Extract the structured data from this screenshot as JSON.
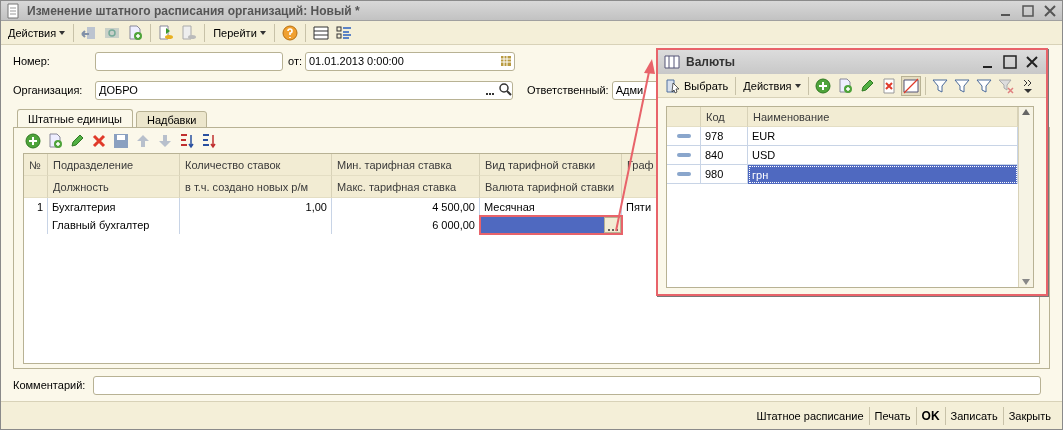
{
  "window": {
    "title": "Изменение штатного расписания организаций: Новый *"
  },
  "toolbar": {
    "actions_menu": "Действия",
    "goto_menu": "Перейти"
  },
  "form": {
    "number": {
      "label": "Номер:"
    },
    "date": {
      "label": "от:",
      "value": "01.01.2013  0:00:00"
    },
    "organization": {
      "label": "Организация:",
      "value": "ДОБРО"
    },
    "responsible": {
      "label": "Ответственный:",
      "value": "Адми"
    }
  },
  "tabs": [
    {
      "label": "Штатные единицы",
      "selected": true
    },
    {
      "label": "Надбавки",
      "selected": false
    }
  ],
  "table": {
    "columns": [
      {
        "header": "№"
      },
      {
        "header": "Подразделение",
        "subheader": "Должность"
      },
      {
        "header": "Количество ставок",
        "subheader": "в т.ч. создано новых р/м"
      },
      {
        "header": "Мин. тарифная ставка",
        "subheader": "Макс. тарифная ставка"
      },
      {
        "header": "Вид тарифной ставки",
        "subheader": "Валюта тарифной ставки"
      },
      {
        "header": "Граф"
      }
    ],
    "rows": [
      {
        "number": "1",
        "department": "Бухгалтерия",
        "position": "Главный бухгалтер",
        "rate_count": "1,00",
        "min_rate": "4 500,00",
        "max_rate": "6 000,00",
        "rate_kind": "Месячная",
        "currency_editing": true,
        "column_6": "Пяти"
      }
    ]
  },
  "comment": {
    "label": "Комментарий:"
  },
  "footer_buttons": [
    {
      "label": "Штатное расписание",
      "default": false
    },
    {
      "label": "Печать",
      "default": false
    },
    {
      "label": "OK",
      "default": true
    },
    {
      "label": "Записать",
      "default": false
    },
    {
      "label": "Закрыть",
      "default": false
    }
  ],
  "popup": {
    "title": "Валюты",
    "select_button": "Выбрать",
    "actions_menu": "Действия",
    "columns": [
      "Код",
      "Наименование"
    ],
    "rows": [
      {
        "code": "978",
        "name": "EUR",
        "selected": false
      },
      {
        "code": "840",
        "name": "USD",
        "selected": false
      },
      {
        "code": "980",
        "name": "грн",
        "selected": true
      }
    ]
  }
}
